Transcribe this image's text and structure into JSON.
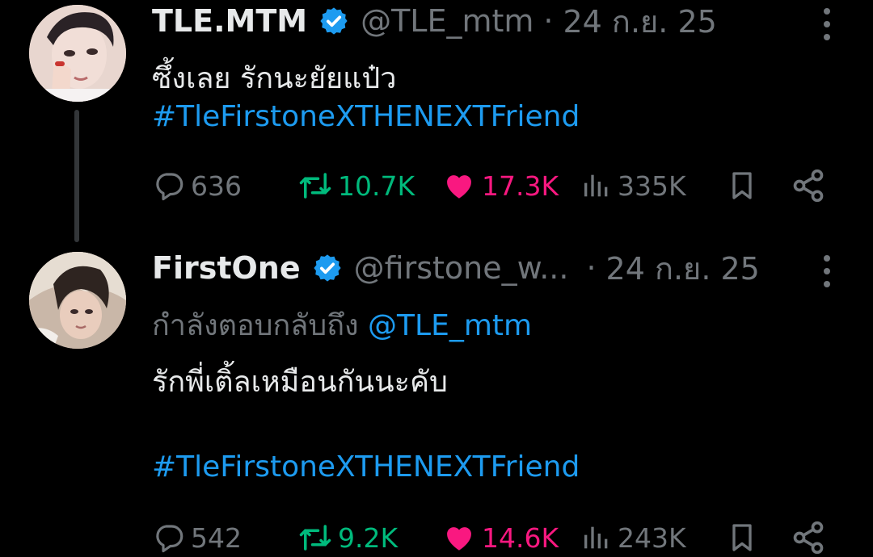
{
  "tweets": [
    {
      "display_name": "TLE.MTM",
      "handle": "@TLE_mtm",
      "separator": "·",
      "date": "24 ก.ย. 25",
      "text": "ซึ้งเลย รักนะยัยแป๋ว",
      "hashtag": "#TleFirstoneXTHENEXTFriend",
      "replies": "636",
      "retweets": "10.7K",
      "likes": "17.3K",
      "views": "335K"
    },
    {
      "display_name": "FirstOne",
      "handle": "@firstone_w...",
      "separator": "·",
      "date": "24 ก.ย. 25",
      "reply_prefix": "กำลังตอบกลับถึง",
      "reply_mention": "@TLE_mtm",
      "text": "รักพี่เติ้ลเหมือนกันนะคับ",
      "hashtag": "#TleFirstoneXTHENEXTFriend",
      "replies": "542",
      "retweets": "9.2K",
      "likes": "14.6K",
      "views": "243K"
    }
  ],
  "colors": {
    "background": "#000000",
    "text": "#e7e9ea",
    "muted": "#71767b",
    "link": "#1d9bf0",
    "retweet": "#00ba7c",
    "like": "#f91880"
  },
  "icons": [
    "verified-badge-icon",
    "more-icon",
    "reply-icon",
    "retweet-icon",
    "heart-icon",
    "views-icon",
    "bookmark-icon",
    "share-icon"
  ]
}
